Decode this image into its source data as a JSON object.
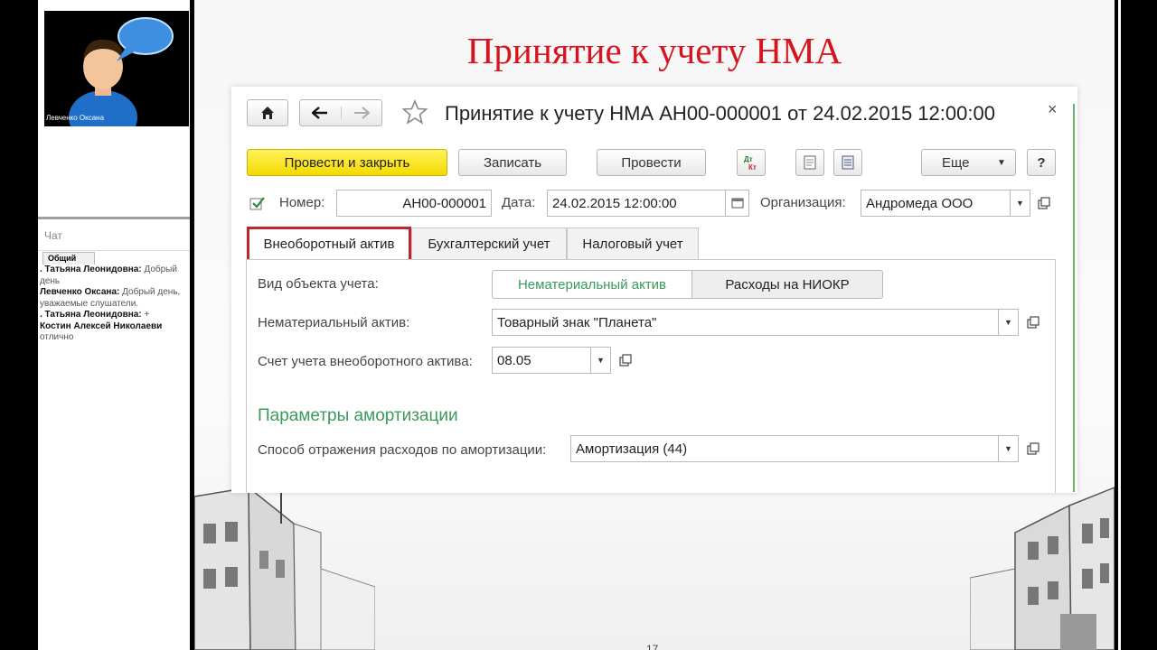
{
  "sidebar": {
    "presenter_name": "Левченко Оксана",
    "chat_header": "Чат",
    "chat_tab": "Общий",
    "messages": [
      {
        "author": ". Татьяна Леонидовна:",
        "text": "Добрый день"
      },
      {
        "author": "Левченко Оксана:",
        "text": "Добрый день, уважаемые слушатели."
      },
      {
        "author": ". Татьяна Леонидовна:",
        "text": "+"
      },
      {
        "author": "Костин Алексей Николаеви",
        "text": "отлично"
      }
    ]
  },
  "slide": {
    "title": "Принятие к учету НМА",
    "page_number": "17"
  },
  "form": {
    "title": "Принятие к учету НМА АН00-000001 от 24.02.2015 12:00:00",
    "close_symbol": "×",
    "toolbar": {
      "post_close": "Провести и закрыть",
      "save": "Записать",
      "post": "Провести",
      "more": "Еще",
      "help": "?"
    },
    "header": {
      "number_label": "Номер:",
      "number_value": "АН00-000001",
      "date_label": "Дата:",
      "date_value": "24.02.2015 12:00:00",
      "org_label": "Организация:",
      "org_value": "Андромеда ООО"
    },
    "tabs": [
      {
        "label": "Внеоборотный актив",
        "active": true
      },
      {
        "label": "Бухгалтерский учет",
        "active": false
      },
      {
        "label": "Налоговый учет",
        "active": false
      }
    ],
    "object_type": {
      "label": "Вид объекта учета:",
      "options": [
        "Нематериальный актив",
        "Расходы на НИОКР"
      ],
      "selected": "Нематериальный актив"
    },
    "intangible_asset": {
      "label": "Нематериальный актив:",
      "value": "Товарный знак \"Планета\""
    },
    "account": {
      "label": "Счет учета внеоборотного актива:",
      "value": "08.05"
    },
    "amortization": {
      "section_title": "Параметры амортизации",
      "method_label": "Способ отражения расходов по амортизации:",
      "method_value": "Амортизация (44)"
    }
  },
  "colors": {
    "title_red": "#d7141e",
    "accent_green": "#3a9a5b",
    "primary_yellow": "#f4d900",
    "active_tab_border": "#c0252b"
  }
}
